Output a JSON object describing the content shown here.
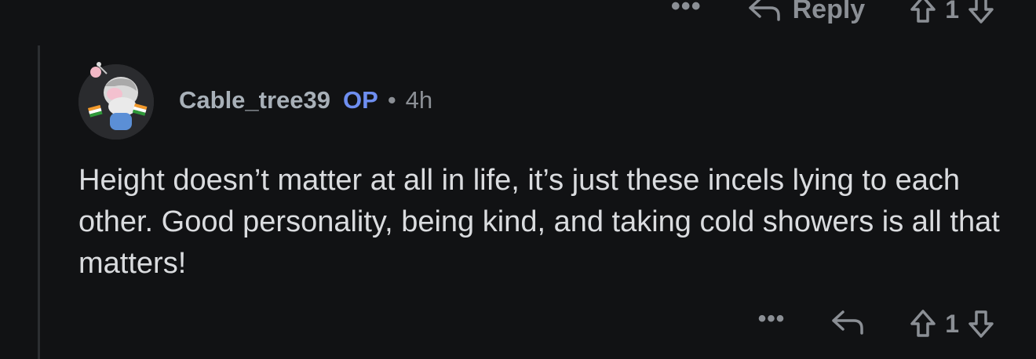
{
  "previous_comment_actions": {
    "more_label": "•••",
    "reply_label": "Reply",
    "vote_count": "1"
  },
  "comment": {
    "author": "Cable_tree39",
    "op_badge": "OP",
    "separator": "•",
    "age": "4h",
    "body": "Height doesn’t matter at all in life, it’s just these incels lying to each other. Good personality, being kind, and taking cold showers is all that matters!",
    "more_label": "•••",
    "vote_count": "1"
  },
  "colors": {
    "background": "#111214",
    "text_primary": "#dadcdf",
    "text_muted": "#8b8f95",
    "username": "#a8b0b8",
    "op_accent": "#6e8ef0"
  },
  "icons": [
    "reply-arrow-icon",
    "upvote-arrow-icon",
    "downvote-arrow-icon",
    "more-options-icon",
    "user-avatar"
  ]
}
